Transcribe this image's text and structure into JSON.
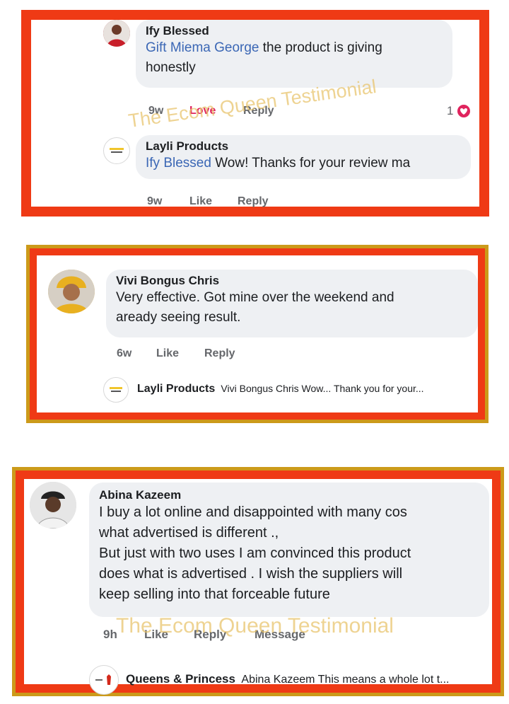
{
  "colors": {
    "frame_red": "#ef3a15",
    "frame_gold": "#cc9a1a",
    "link_blue": "#3b67b5",
    "love_red": "#e0245e",
    "bubble_gray": "#eef0f3",
    "watermark": "#e8c46e"
  },
  "watermark_text": "The Ecom Queen Testimonial",
  "card1": {
    "comment": {
      "author": "Ify Blessed",
      "mention": "Gift Miema George",
      "text_line1": " the product is giving",
      "text_line2": "honestly"
    },
    "actions": {
      "time": "9w",
      "love": "Love",
      "reply": "Reply",
      "reaction_count": "1"
    },
    "reply": {
      "author": "Layli Products",
      "mention": "Ify Blessed",
      "text": " Wow! Thanks for your review ma"
    },
    "reply_actions": {
      "time": "9w",
      "like": "Like",
      "reply": "Reply"
    }
  },
  "card2": {
    "comment": {
      "author": "Vivi Bongus Chris",
      "text_line1": "Very effective.  Got mine over the weekend and",
      "text_line2": "aready seeing result."
    },
    "actions": {
      "time": "6w",
      "like": "Like",
      "reply": "Reply"
    },
    "reply": {
      "author": "Layli Products",
      "text": "Vivi Bongus Chris Wow... Thank you for your..."
    }
  },
  "card3": {
    "comment": {
      "author": "Abina Kazeem",
      "lines": [
        "I buy a lot online and disappointed with many cos",
        "what advertised is different .,",
        "But just with two uses I am convinced this product",
        "does what is advertised . I wish the suppliers will",
        "keep selling into that forceable future"
      ]
    },
    "actions": {
      "time": "9h",
      "like": "Like",
      "reply": "Reply",
      "message": "Message"
    },
    "reply": {
      "author": "Queens & Princess",
      "text": "Abina Kazeem This means a whole lot t..."
    }
  }
}
